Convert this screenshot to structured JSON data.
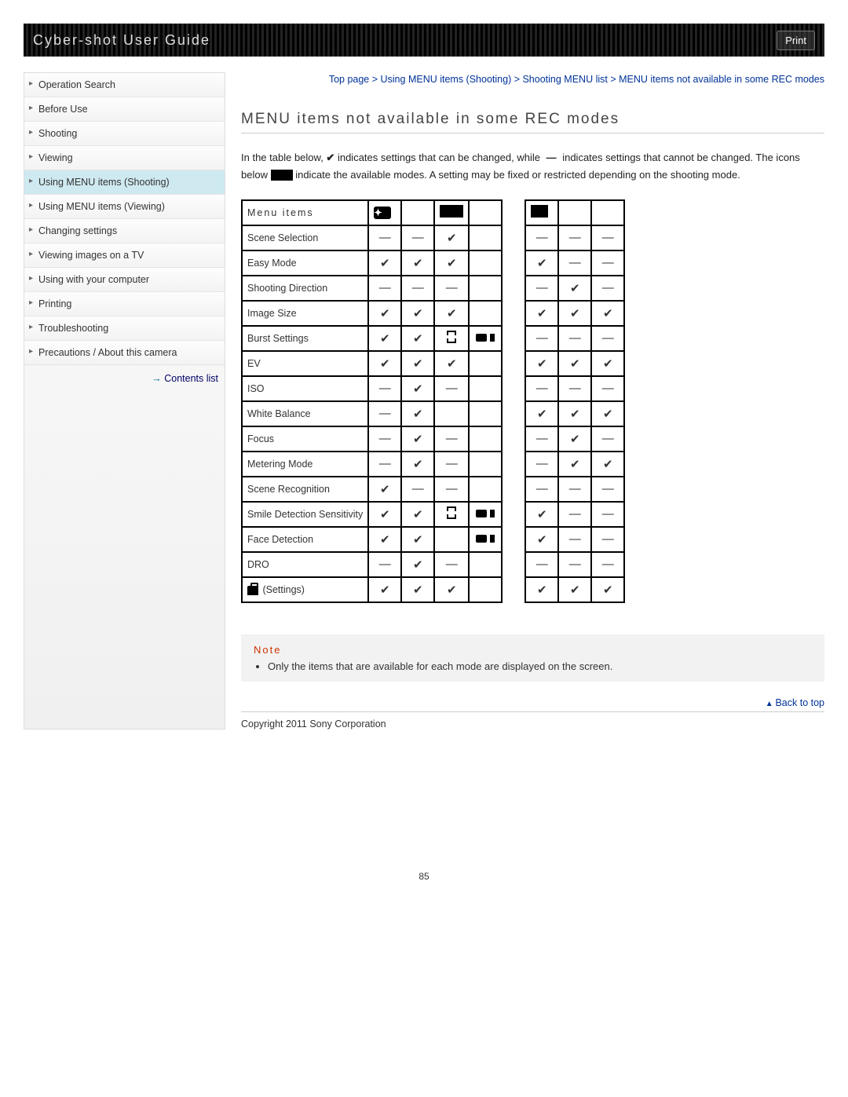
{
  "header": {
    "title": "Cyber-shot User Guide",
    "print": "Print"
  },
  "sidebar": {
    "items": [
      {
        "label": "Operation Search",
        "active": false
      },
      {
        "label": "Before Use",
        "active": false
      },
      {
        "label": "Shooting",
        "active": false
      },
      {
        "label": "Viewing",
        "active": false
      },
      {
        "label": "Using MENU items (Shooting)",
        "active": true
      },
      {
        "label": "Using MENU items (Viewing)",
        "active": false
      },
      {
        "label": "Changing settings",
        "active": false
      },
      {
        "label": "Viewing images on a TV",
        "active": false
      },
      {
        "label": "Using with your computer",
        "active": false
      },
      {
        "label": "Printing",
        "active": false
      },
      {
        "label": "Troubleshooting",
        "active": false
      },
      {
        "label": "Precautions / About this camera",
        "active": false
      }
    ],
    "contents_link": "Contents list"
  },
  "breadcrumb": "Top page > Using MENU items (Shooting) > Shooting MENU list > MENU items not available in some REC modes",
  "page_title": "MENU items not available in some REC modes",
  "intro": {
    "p1a": "In the table below, ",
    "p1b": " indicates settings that can be changed, while ",
    "p1c": " indicates settings that cannot be changed. The icons below ",
    "p1d": " indicate the available modes. A setting may be fixed or restricted depending on the shooting mode."
  },
  "table": {
    "header_label": "Menu items",
    "rows": [
      {
        "label": "Scene Selection",
        "c": [
          "—",
          "—",
          "✔",
          "",
          "—",
          "—",
          "—"
        ]
      },
      {
        "label": "Easy Mode",
        "c": [
          "✔",
          "✔",
          "✔",
          "",
          "✔",
          "—",
          "—"
        ]
      },
      {
        "label": "Shooting Direction",
        "c": [
          "—",
          "—",
          "—",
          "",
          "—",
          "✔",
          "—"
        ]
      },
      {
        "label": "Image Size",
        "c": [
          "✔",
          "✔",
          "✔",
          "",
          "✔",
          "✔",
          "✔"
        ]
      },
      {
        "label": "Burst Settings",
        "c": [
          "✔",
          "✔",
          "ic1",
          "ic2",
          "—",
          "—",
          "—"
        ]
      },
      {
        "label": "EV",
        "c": [
          "✔",
          "✔",
          "✔",
          "",
          "✔",
          "✔",
          "✔"
        ]
      },
      {
        "label": "ISO",
        "c": [
          "—",
          "✔",
          "—",
          "",
          "—",
          "—",
          "—"
        ]
      },
      {
        "label": "White Balance",
        "c": [
          "—",
          "✔",
          "",
          "",
          "✔",
          "✔",
          "✔"
        ]
      },
      {
        "label": "Focus",
        "c": [
          "—",
          "✔",
          "—",
          "",
          "—",
          "✔",
          "—"
        ]
      },
      {
        "label": "Metering Mode",
        "c": [
          "—",
          "✔",
          "—",
          "",
          "—",
          "✔",
          "✔"
        ]
      },
      {
        "label": "Scene Recognition",
        "c": [
          "✔",
          "—",
          "—",
          "",
          "—",
          "—",
          "—"
        ]
      },
      {
        "label": "Smile Detection Sensitivity",
        "c": [
          "✔",
          "✔",
          "ic1",
          "ic2",
          "✔",
          "—",
          "—"
        ]
      },
      {
        "label": "Face Detection",
        "c": [
          "✔",
          "✔",
          "",
          "ic2",
          "✔",
          "—",
          "—"
        ]
      },
      {
        "label": "DRO",
        "c": [
          "—",
          "✔",
          "—",
          "",
          "—",
          "—",
          "—"
        ]
      },
      {
        "label": " (Settings)",
        "icon": true,
        "c": [
          "✔",
          "✔",
          "✔",
          "",
          "✔",
          "✔",
          "✔"
        ]
      }
    ]
  },
  "note": {
    "title": "Note",
    "item": "Only the items that are available for each mode are displayed on the screen."
  },
  "back_to_top": "Back to top",
  "copyright": "Copyright 2011 Sony Corporation",
  "page_number": "85"
}
